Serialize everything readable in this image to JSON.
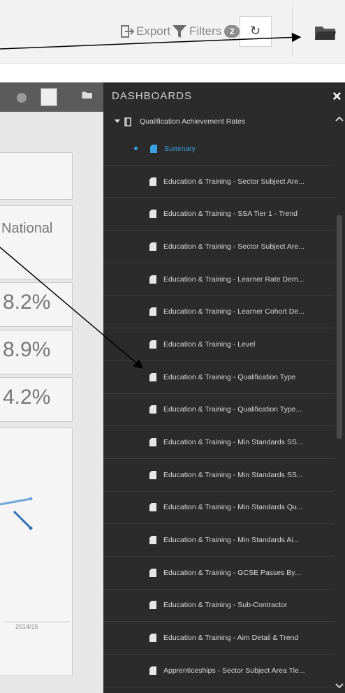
{
  "toolbar": {
    "export_label": "Export",
    "filters_label": "Filters",
    "filters_count": "2",
    "reset_glyph": "↻"
  },
  "background_dashboard": {
    "national_label": "National",
    "values": [
      "8.2%",
      "8.9%",
      "4.2%"
    ],
    "year_label": "2014/15"
  },
  "sidebar": {
    "title": "DASHBOARDS",
    "close_glyph": "×",
    "parent": "Qualification Achievement Rates",
    "items": [
      {
        "label": "Summary",
        "active": true
      },
      {
        "label": "Education & Training - Sector Subject Are..."
      },
      {
        "label": "Education & Training - SSA Tier 1 - Trend"
      },
      {
        "label": "Education & Training - Sector Subject Are..."
      },
      {
        "label": "Education & Training - Learner Rate Dem..."
      },
      {
        "label": "Education & Training - Learner Cohort De..."
      },
      {
        "label": "Education & Training - Level"
      },
      {
        "label": "Education & Training - Qualification Type"
      },
      {
        "label": "Education & Training - Qualification Type..."
      },
      {
        "label": "Education & Training - Min Standards SS..."
      },
      {
        "label": "Education & Training - Min Standards SS..."
      },
      {
        "label": "Education & Training - Min Standards Qu..."
      },
      {
        "label": "Education & Training - Min Standards Ai..."
      },
      {
        "label": "Education & Training - GCSE Passes By..."
      },
      {
        "label": "Education & Training - Sub-Contractor"
      },
      {
        "label": "Education & Training - Aim Detail & Trend"
      },
      {
        "label": "Apprenticeships - Sector Subject Area Tie..."
      }
    ]
  },
  "colors": {
    "sidebar_bg": "#2b2b2b",
    "active": "#3aa0e0",
    "toolbar_bg": "#f2f2f2"
  }
}
